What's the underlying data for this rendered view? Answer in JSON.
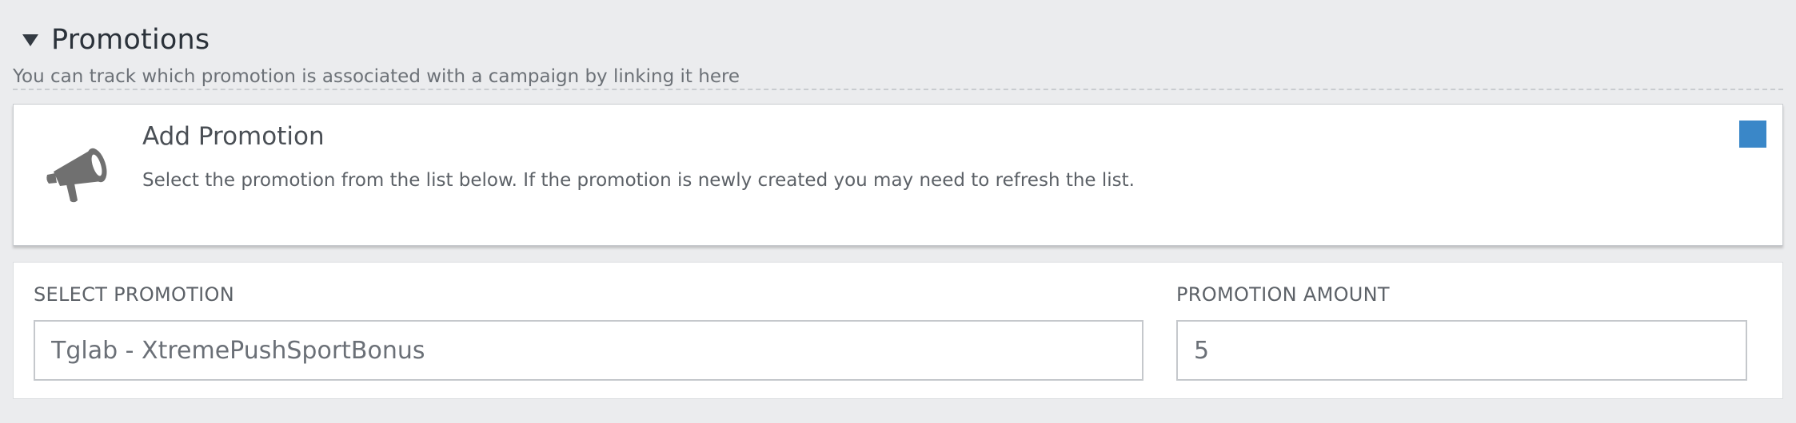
{
  "section": {
    "title": "Promotions",
    "subtitle": "You can track which promotion is associated with a campaign by linking it here"
  },
  "info_card": {
    "icon": "megaphone-icon",
    "title": "Add Promotion",
    "description": "Select the promotion from the list below. If the promotion is newly created you may need to refresh the list.",
    "accent_color": "#3a87c8"
  },
  "form": {
    "promotion": {
      "label": "SELECT PROMOTION",
      "value": "Tglab - XtremePushSportBonus"
    },
    "amount": {
      "label": "PROMOTION AMOUNT",
      "value": "5"
    }
  }
}
